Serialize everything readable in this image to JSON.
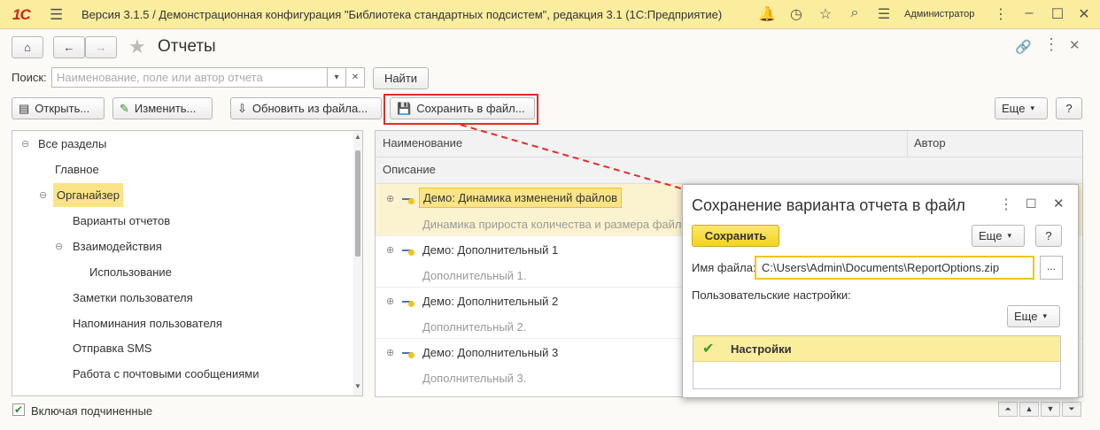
{
  "titlebar": {
    "logo": "1С",
    "title": "Версия 3.1.5 / Демонстрационная конфигурация \"Библиотека стандартных подсистем\", редакция 3.1  (1С:Предприятие)",
    "user": "Администратор",
    "icons": [
      "bell-icon",
      "history-icon",
      "star-icon",
      "search-icon",
      "menu-icon",
      "minimize-icon",
      "maximize-icon",
      "close-icon"
    ]
  },
  "page": {
    "title": "Отчеты"
  },
  "search": {
    "label": "Поиск:",
    "placeholder": "Наименование, поле или автор отчета",
    "find_label": "Найти"
  },
  "toolbar": {
    "open_label": "Открыть...",
    "edit_label": "Изменить...",
    "update_label": "Обновить из файла...",
    "save_label": "Сохранить в файл...",
    "more_label": "Еще",
    "help_label": "?"
  },
  "tree": {
    "items": [
      {
        "label": "Все разделы"
      },
      {
        "label": "Главное"
      },
      {
        "label": "Органайзер"
      },
      {
        "label": "Варианты отчетов"
      },
      {
        "label": "Взаимодействия"
      },
      {
        "label": "Использование"
      },
      {
        "label": "Заметки пользователя"
      },
      {
        "label": "Напоминания пользователя"
      },
      {
        "label": "Отправка SMS"
      },
      {
        "label": "Работа с почтовыми сообщениями"
      }
    ],
    "include_sub_label": "Включая подчиненные"
  },
  "grid": {
    "col_name": "Наименование",
    "col_author": "Автор",
    "col_desc": "Описание",
    "rows": [
      {
        "name": "Демо: Динамика изменений файлов",
        "desc": "Динамика прироста количества и размера файлов"
      },
      {
        "name": "Демо: Дополнительный 1",
        "desc": "Дополнительный 1."
      },
      {
        "name": "Демо: Дополнительный 2",
        "desc": "Дополнительный 2."
      },
      {
        "name": "Демо: Дополнительный 3",
        "desc": "Дополнительный 3."
      }
    ]
  },
  "dialog": {
    "title": "Сохранение варианта отчета в файл",
    "save_label": "Сохранить",
    "more_label": "Еще",
    "help_label": "?",
    "filename_label": "Имя файла:",
    "filename_value": "C:\\Users\\Admin\\Documents\\ReportOptions.zip",
    "browse_label": "...",
    "user_settings_label": "Пользовательские настройки:",
    "more2_label": "Еще",
    "settings_header": "Настройки"
  },
  "colors": {
    "titlebar": "#fbed9e",
    "accent_yellow": "#f3d41b",
    "highlight": "#e32b2b",
    "row_selected": "#fbf3cf"
  }
}
